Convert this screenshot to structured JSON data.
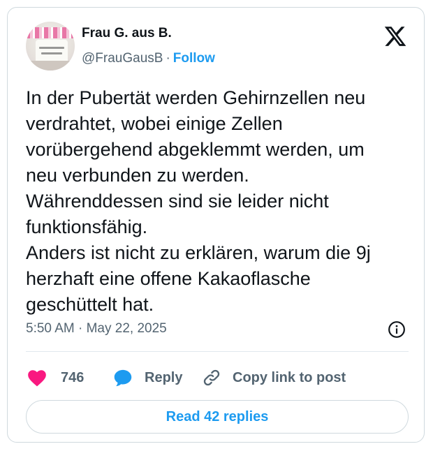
{
  "author": {
    "display_name": "Frau G. aus B.",
    "handle": "@FrauGausB",
    "separator": "·",
    "follow_label": "Follow"
  },
  "tweet": {
    "text": "In der Pubertät werden Gehirnzellen neu\nverdrahtet, wobei einige Zellen\nvorübergehend abgeklemmt werden, um\nneu verbunden zu werden.\nWährenddessen sind sie leider nicht\nfunktionsfähig.\nAnders ist nicht zu erklären, warum die 9j\nherzhaft eine offene Kakaoflasche\ngeschüttelt hat.",
    "time": "5:50 AM",
    "separator": "·",
    "date": "May 22, 2025"
  },
  "actions": {
    "like_count": "746",
    "reply_label": "Reply",
    "copy_label": "Copy link to post"
  },
  "footer": {
    "read_replies_label": "Read 42 replies"
  },
  "colors": {
    "accent": "#1d9bf0",
    "like": "#f91880",
    "text": "#0f1419",
    "muted": "#536471",
    "border": "#cfd9de"
  },
  "icons": {
    "brand": "x-logo-icon",
    "info": "info-icon",
    "like": "heart-icon",
    "reply": "speech-bubble-icon",
    "copy": "link-icon"
  }
}
